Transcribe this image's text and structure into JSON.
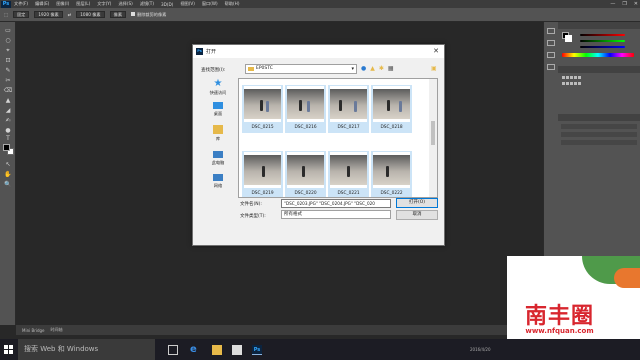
{
  "app": {
    "logo": "Ps",
    "menu": [
      "文件(F)",
      "编辑(E)",
      "图像(I)",
      "图层(L)",
      "文字(Y)",
      "选择(S)",
      "滤镜(T)",
      "3D(D)",
      "视图(V)",
      "窗口(W)",
      "帮助(H)"
    ],
    "window_controls": [
      "—",
      "❐",
      "✕"
    ]
  },
  "options": {
    "tool_icon": "⬚",
    "style_value": "固定",
    "width_value": "1920 像素",
    "height_value": "1080 像素",
    "unit_value": "像素",
    "checkbox_label": "删除裁剪的像素"
  },
  "tools": [
    "▭",
    "○",
    "⌖",
    "⊡",
    "✎",
    "✂",
    "⌫",
    "▲",
    "◢",
    "✍",
    "●",
    "T",
    "↖",
    "✋",
    "🔍"
  ],
  "dialog": {
    "title": "打开",
    "look_in_label": "查找范围(I):",
    "folder": "EP0STC",
    "places": [
      {
        "label": "快速访问",
        "icon": "star-icon",
        "color": "#2f8fe0"
      },
      {
        "label": "桌面",
        "icon": "desktop-icon",
        "color": "#2f8fe0"
      },
      {
        "label": "库",
        "icon": "library-icon",
        "color": "#e6b94a"
      },
      {
        "label": "此电脑",
        "icon": "computer-icon",
        "color": "#3b7fc4"
      },
      {
        "label": "网络",
        "icon": "network-icon",
        "color": "#3b7fc4"
      }
    ],
    "files": [
      {
        "name": "DSC_0215"
      },
      {
        "name": "DSC_0216"
      },
      {
        "name": "DSC_0217"
      },
      {
        "name": "DSC_0218"
      },
      {
        "name": "DSC_0219"
      },
      {
        "name": "DSC_0220"
      },
      {
        "name": "DSC_0221"
      },
      {
        "name": "DSC_0222"
      }
    ],
    "filename_label": "文件名(N):",
    "filename_value": "\"DSC_0203.JPG\" \"DSC_0204.JPG\" \"DSC_020",
    "filetype_label": "文件类型(T):",
    "filetype_value": "所有格式",
    "open_button": "打开(O)",
    "cancel_button": "取消"
  },
  "status": {
    "doc_tab": "Mini Bridge",
    "timeline_tab": "时间轴"
  },
  "taskbar": {
    "search_placeholder": "搜索 Web 和 Windows",
    "clock": "2016/4/20"
  },
  "watermark": {
    "title": "南丰圈",
    "url": "www.nfquan.com"
  },
  "colors": {
    "accent": "#0078d7",
    "ps_blue": "#31a8ff",
    "brand_red": "#d8262e"
  }
}
